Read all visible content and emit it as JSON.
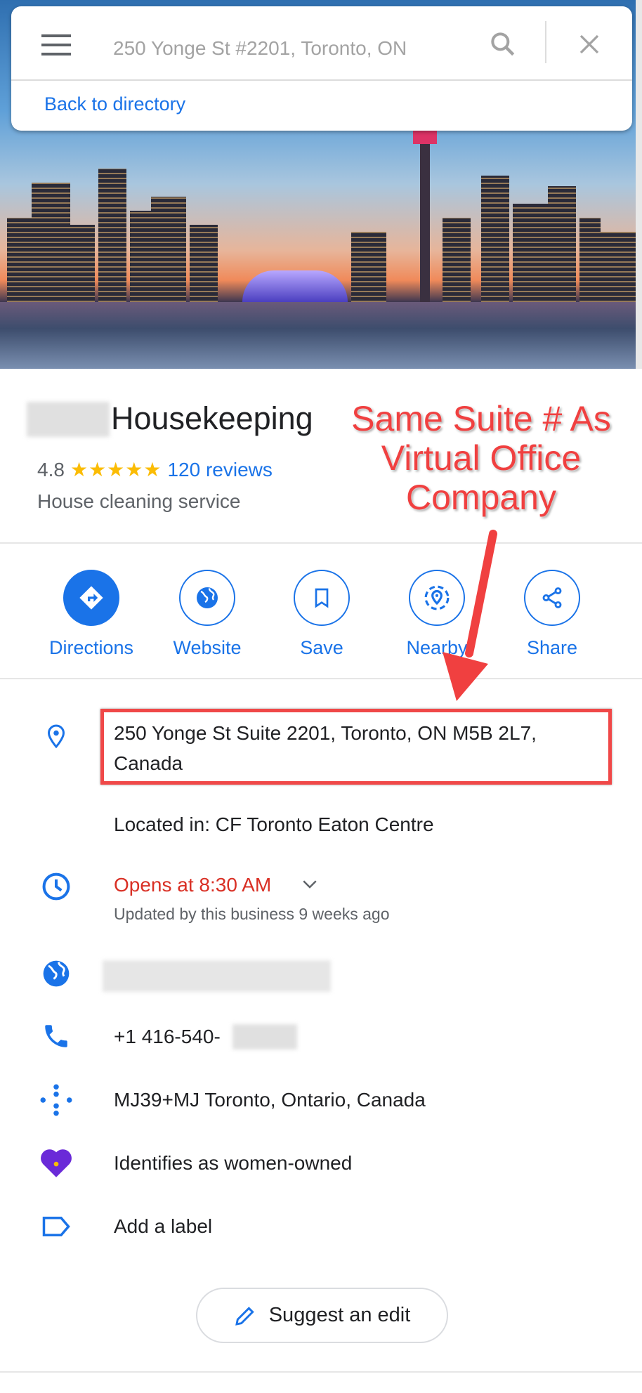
{
  "search": {
    "value": "250 Yonge St #2201, Toronto, ON",
    "back_link": "Back to directory"
  },
  "place": {
    "title": "Housekeeping",
    "rating": "4.8",
    "stars": "★★★★★",
    "reviews": "120 reviews",
    "category": "House cleaning service"
  },
  "actions": [
    {
      "label": "Directions"
    },
    {
      "label": "Website"
    },
    {
      "label": "Save"
    },
    {
      "label": "Nearby"
    },
    {
      "label": "Share"
    }
  ],
  "details": {
    "address_line1": "250 Yonge St Suite 2201, Toronto, ON M5B 2L7,",
    "address_line2": "Canada",
    "located_in": "Located in: CF Toronto Eaton Centre",
    "hours_status": "Opens at 8:30 AM",
    "hours_updated": "Updated by this business 9 weeks ago",
    "phone": "+1 416-540-",
    "plus_code": "MJ39+MJ Toronto, Ontario, Canada",
    "women_owned": "Identifies as women-owned",
    "add_label": "Add a label"
  },
  "suggest_edit": "Suggest an edit",
  "annotation": {
    "line1": "Same Suite # As",
    "line2": "Virtual Office",
    "line3": "Company"
  },
  "colors": {
    "accent": "#1a73e8",
    "hours_red": "#d93025",
    "annotation_red": "#f04040"
  }
}
